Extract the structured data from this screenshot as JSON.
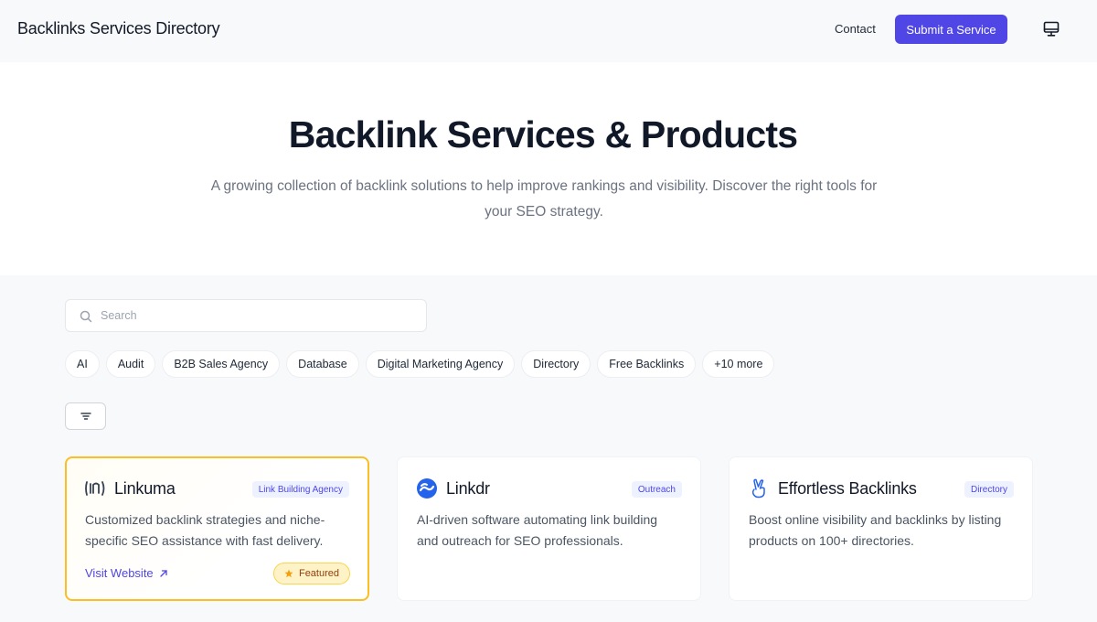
{
  "header": {
    "brand": "Backlinks Services Directory",
    "contact_label": "Contact",
    "submit_label": "Submit a Service",
    "theme_icon": "monitor-icon"
  },
  "hero": {
    "title": "Backlink Services & Products",
    "subtitle": "A growing collection of backlink solutions to help improve rankings and visibility. Discover the right tools for your SEO strategy."
  },
  "search": {
    "placeholder": "Search",
    "value": ""
  },
  "tags": [
    "AI",
    "Audit",
    "B2B Sales Agency",
    "Database",
    "Digital Marketing Agency",
    "Directory",
    "Free Backlinks",
    "+10 more"
  ],
  "cards": [
    {
      "name": "Linkuma",
      "category": "Link Building Agency",
      "description": "Customized backlink strategies and niche-specific SEO assistance with fast delivery.",
      "visit_label": "Visit Website",
      "featured_label": "Featured",
      "logo_icon": "linkuma-logo-icon"
    },
    {
      "name": "Linkdr",
      "category": "Outreach",
      "description": "AI-driven software automating link building and outreach for SEO professionals.",
      "logo_icon": "linkdr-logo-icon"
    },
    {
      "name": "Effortless Backlinks",
      "category": "Directory",
      "description": "Boost online visibility and backlinks by listing products on 100+ directories.",
      "logo_icon": "fingers-crossed-icon"
    }
  ],
  "colors": {
    "accent": "#4f46e5",
    "featured_border": "#fbbf24",
    "featured_bg": "#fef3c7",
    "linkdr_blue": "#2563eb"
  }
}
